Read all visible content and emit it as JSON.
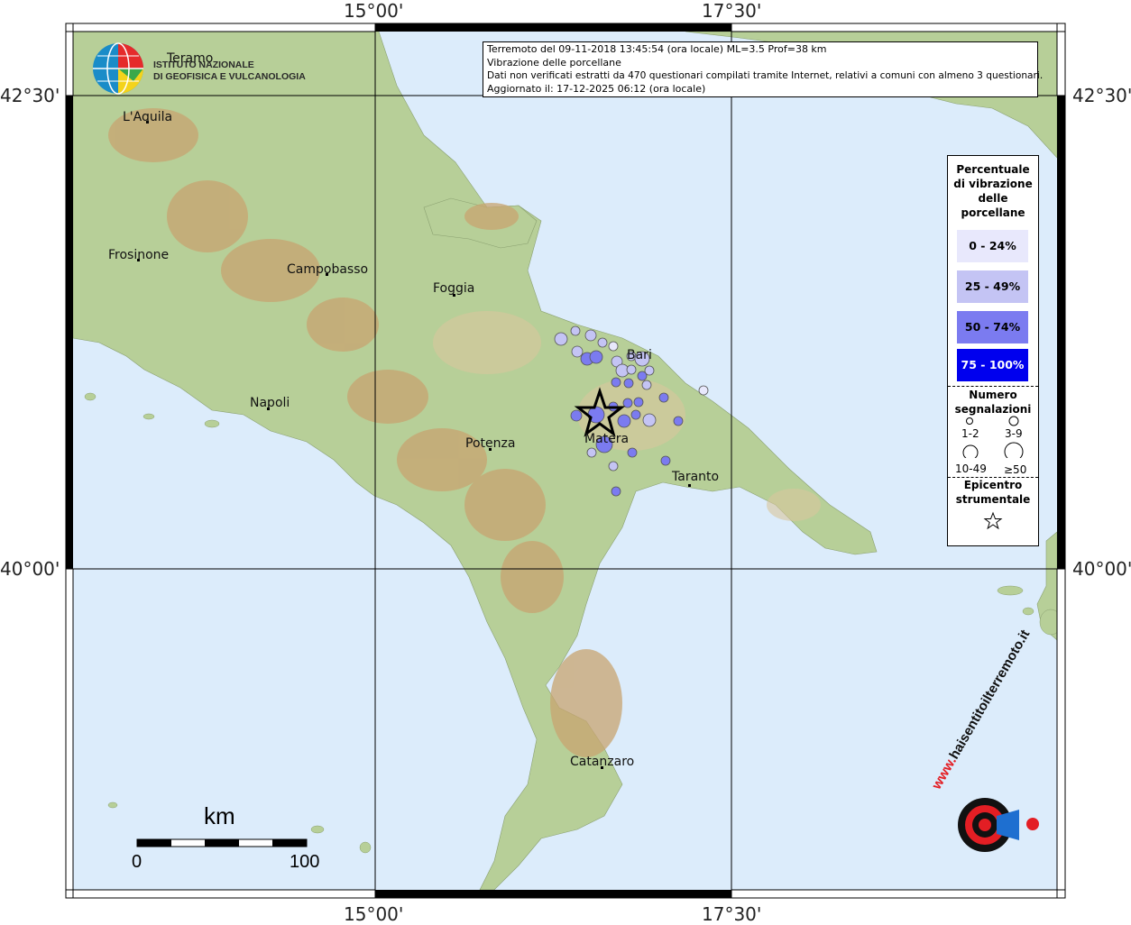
{
  "coordinates": {
    "top_lon": [
      "15°00'",
      "17°30'"
    ],
    "bottom_lon": [
      "15°00'",
      "17°30'"
    ],
    "left_lat": [
      "42°30'",
      "40°00'"
    ],
    "right_lat": [
      "42°30'",
      "40°00'"
    ]
  },
  "logo": {
    "line1": "ISTITUTO NAZIONALE",
    "line2": "DI GEOFISICA E VULCANOLOGIA"
  },
  "info": {
    "line1": "Terremoto del 09-11-2018 13:45:54 (ora locale) ML=3.5 Prof=38 km",
    "line2": "Vibrazione delle porcellane",
    "line3": "Dati non verificati estratti da 470 questionari compilati tramite Internet, relativi a comuni con almeno 3 questionari.",
    "line4": "Aggiornato il: 17-12-2025 06:12 (ora locale)"
  },
  "cities": [
    {
      "name": "Teramo"
    },
    {
      "name": "L'Aquila"
    },
    {
      "name": "Frosinone"
    },
    {
      "name": "Campobasso"
    },
    {
      "name": "Foggia"
    },
    {
      "name": "Napoli"
    },
    {
      "name": "Potenza"
    },
    {
      "name": "Bari"
    },
    {
      "name": "Matera"
    },
    {
      "name": "Taranto"
    },
    {
      "name": "Catanzaro"
    }
  ],
  "legend": {
    "title": [
      "Percentuale",
      "di vibrazione",
      "delle",
      "porcellane"
    ],
    "classes": [
      {
        "label": "0 - 24%",
        "color": "#e8e8fc",
        "text_color": "#000000"
      },
      {
        "label": "25 - 49%",
        "color": "#c4c4f4",
        "text_color": "#000000"
      },
      {
        "label": "50 - 74%",
        "color": "#7b7bf0",
        "text_color": "#000000"
      },
      {
        "label": "75 - 100%",
        "color": "#0000ee",
        "text_color": "#ffffff"
      }
    ],
    "count_title": [
      "Numero",
      "segnalazioni"
    ],
    "counts": [
      "1-2",
      "3-9",
      "10-49",
      "≥50"
    ],
    "epicenter_title": [
      "Epicentro",
      "strumentale"
    ]
  },
  "scale": {
    "unit": "km",
    "min": "0",
    "max": "100"
  },
  "brand": {
    "text": "haisentitoilterremoto.it",
    "prefix": "www."
  },
  "colors": {
    "sea": "#dcecfb",
    "land": "#b7cf98",
    "relief": "#c8a470",
    "frame": "#000000",
    "grid": "#000000"
  }
}
